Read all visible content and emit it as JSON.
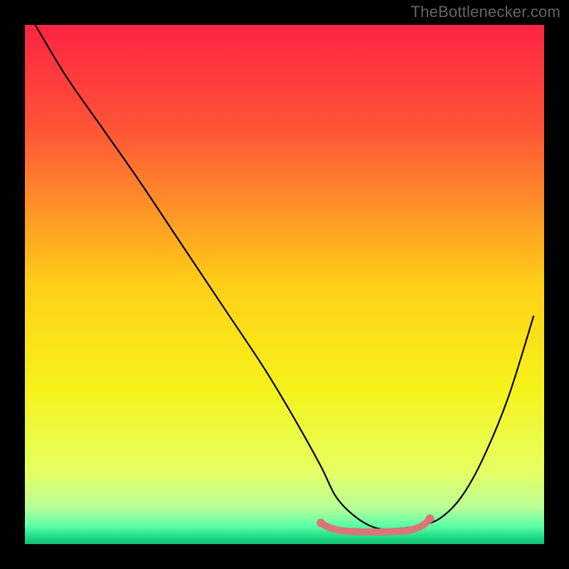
{
  "watermark": "TheBottlenecker.com",
  "chart_data": {
    "type": "line",
    "title": "",
    "xlabel": "",
    "ylabel": "",
    "xlim": [
      0,
      100
    ],
    "ylim": [
      0,
      100
    ],
    "background_gradient_stops": [
      {
        "offset": 0,
        "color": "#ff2443"
      },
      {
        "offset": 0.2,
        "color": "#ff5437"
      },
      {
        "offset": 0.5,
        "color": "#ffcf17"
      },
      {
        "offset": 0.7,
        "color": "#f5f31a"
      },
      {
        "offset": 0.86,
        "color": "#e5ff62"
      },
      {
        "offset": 0.93,
        "color": "#b8ff97"
      },
      {
        "offset": 0.965,
        "color": "#5cffa7"
      },
      {
        "offset": 0.985,
        "color": "#22de86"
      },
      {
        "offset": 1.0,
        "color": "#0fc073"
      }
    ],
    "series": [
      {
        "name": "bottleneck-curve",
        "x": [
          2,
          8,
          15,
          22,
          30,
          38,
          46,
          52,
          57,
          60,
          64,
          68,
          72,
          76,
          80,
          84,
          88,
          93,
          98
        ],
        "y": [
          100,
          90,
          80,
          70,
          58,
          46,
          34,
          24,
          15,
          9,
          5,
          3,
          3,
          3.5,
          5,
          9,
          16,
          28,
          44
        ]
      }
    ],
    "floor_segment": {
      "x_start": 57,
      "x_end": 78,
      "y": 3
    }
  },
  "colors": {
    "frame": "#000000",
    "curve": "#000000",
    "floor_marker": "#db7676",
    "floor_dot": "#db7676"
  }
}
